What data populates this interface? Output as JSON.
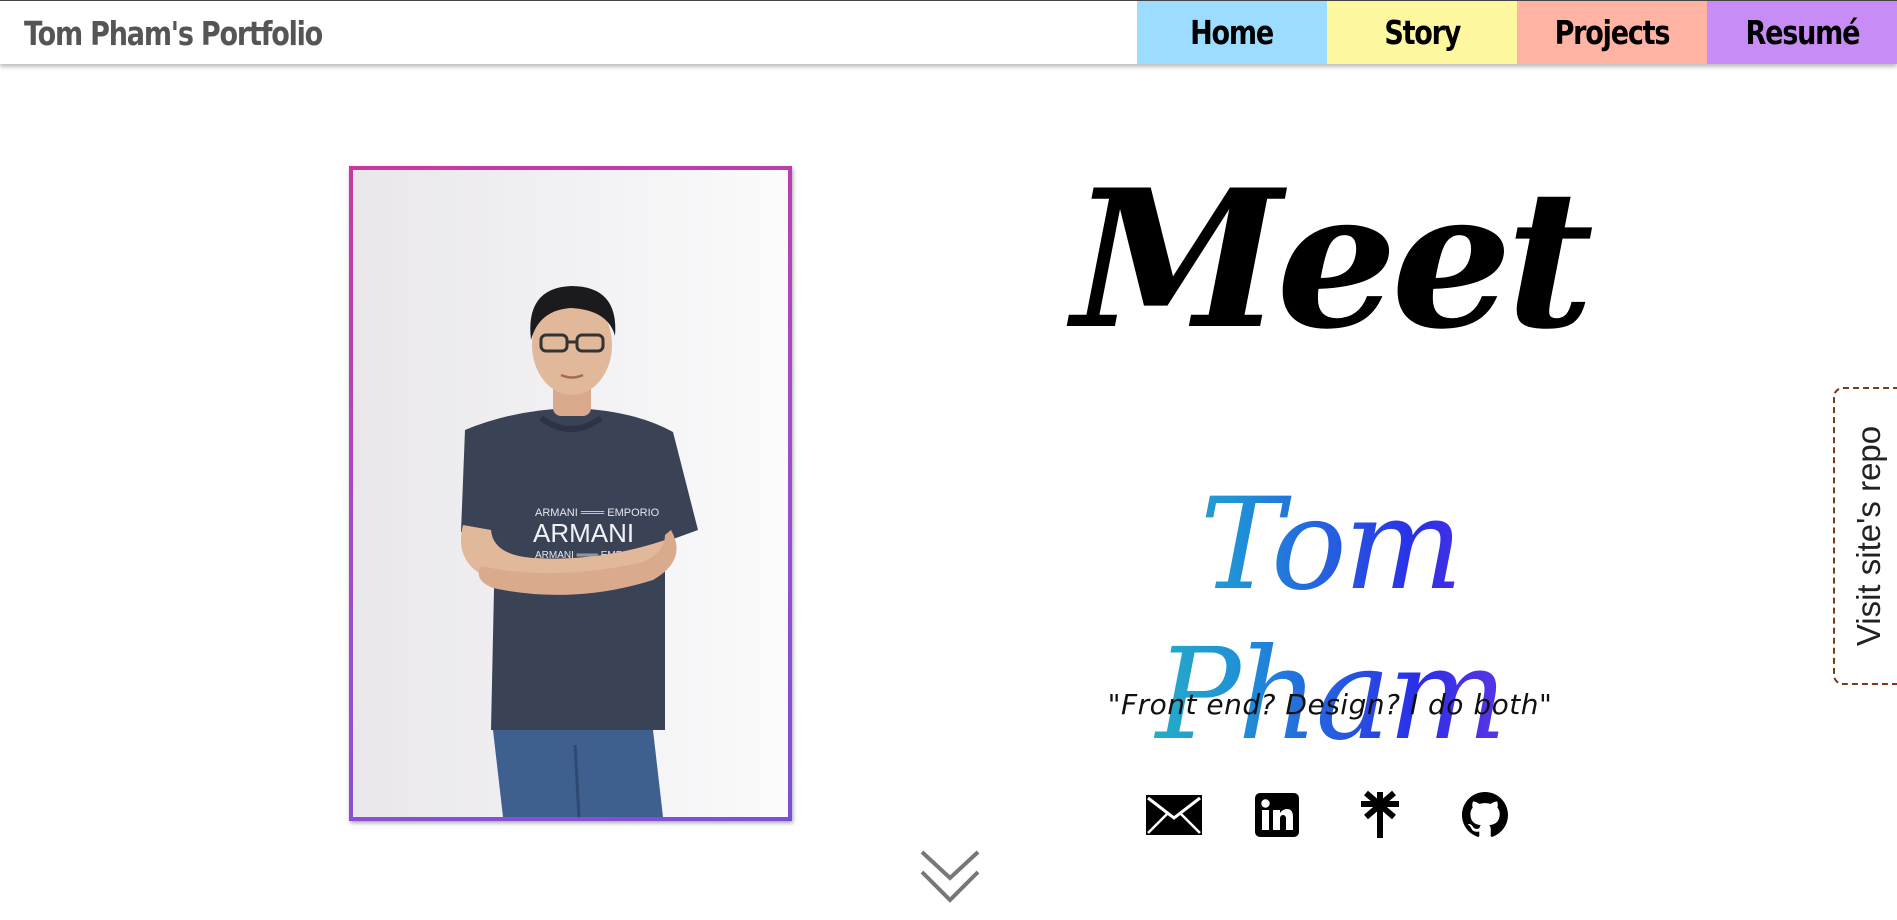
{
  "navbar": {
    "brand": "Tom Pham's Portfolio",
    "links": [
      {
        "label": "Home",
        "color": "#9cdcff"
      },
      {
        "label": "Story",
        "color": "#fdf7a0"
      },
      {
        "label": "Projects",
        "color": "#ffb3a3"
      },
      {
        "label": "Resumé",
        "color": "#c88cf7"
      }
    ]
  },
  "hero": {
    "heading": "Meet",
    "name": "Tom Pham",
    "tagline": "\"Front end? Design? I do both\"",
    "name_gradient": [
      "#2fd2b0",
      "#1f8fd8",
      "#2b2ee8",
      "#9a3fdd"
    ],
    "photo_border_colors": [
      "#c9389f",
      "#7b4fd8"
    ],
    "shirt_text": "ARMANI"
  },
  "socials": [
    {
      "icon": "envelope-icon"
    },
    {
      "icon": "linkedin-icon"
    },
    {
      "icon": "linktree-icon"
    },
    {
      "icon": "github-icon"
    }
  ],
  "scroll_hint": {
    "icon": "double-chevron-down-icon"
  },
  "repo_tab": {
    "label": "Visit site's repo",
    "border_color": "#7a3b1a"
  }
}
